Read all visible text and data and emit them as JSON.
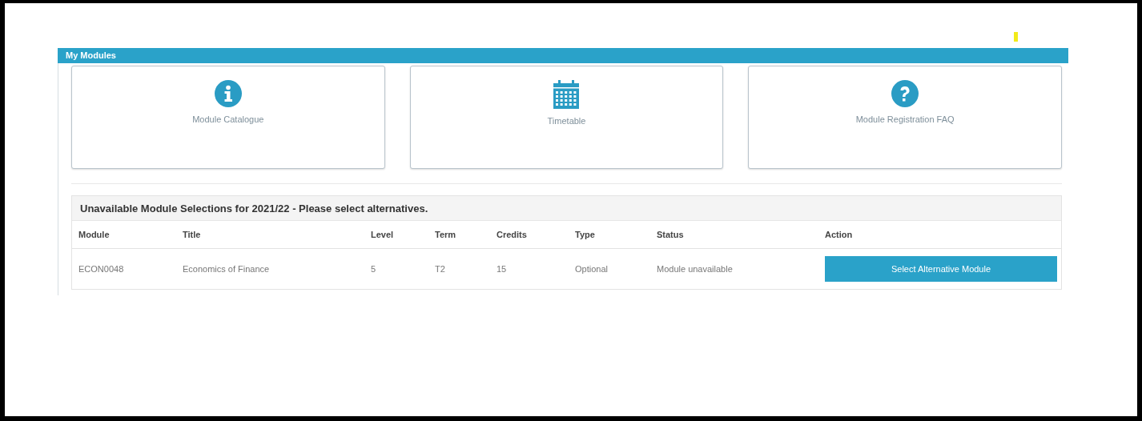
{
  "panel": {
    "title": "My Modules"
  },
  "links": [
    {
      "kind": "info",
      "label": "Module Catalogue"
    },
    {
      "kind": "calendar",
      "label": "Timetable"
    },
    {
      "kind": "help",
      "label": "Module Registration FAQ"
    }
  ],
  "table": {
    "title": "Unavailable Module Selections for 2021/22 - Please select alternatives.",
    "columns": [
      "Module",
      "Title",
      "Level",
      "Term",
      "Credits",
      "Type",
      "Status",
      "Action"
    ],
    "rows": [
      {
        "cells": [
          "ECON0048",
          "Economics of Finance",
          "5",
          "T2",
          "15",
          "Optional",
          "Module unavailable"
        ],
        "action": "Select Alternative Module"
      }
    ]
  }
}
